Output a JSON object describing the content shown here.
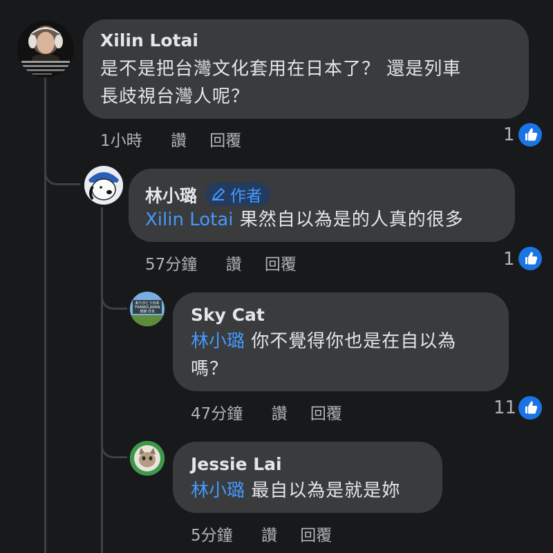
{
  "comments": [
    {
      "author": "Xilin Lotai",
      "text_lines": [
        "是不是把台灣文化套用在日本了？ 還是列車",
        "長歧視台灣人呢？"
      ],
      "time": "1小時",
      "like_label": "讚",
      "reply_label": "回覆",
      "like_count": "1"
    },
    {
      "author": "林小璐",
      "author_badge": "作者",
      "mention": "Xilin Lotai",
      "text": "果然自以為是的人真的很多",
      "time": "57分鐘",
      "like_label": "讚",
      "reply_label": "回覆",
      "like_count": "1"
    },
    {
      "author": "Sky Cat",
      "mention": "林小璐",
      "text_line1": "你不覺得你也是在自以為",
      "text_line2": "嗎？",
      "time": "47分鐘",
      "like_label": "讚",
      "reply_label": "回覆",
      "like_count": "11",
      "avatar_text_1": "ありがとう日本",
      "avatar_text_2": "THANKS JAPAN",
      "avatar_text_3": "感謝 日本"
    },
    {
      "author": "Jessie Lai",
      "mention": "林小璐",
      "text": "最自以為是就是妳",
      "time": "5分鐘",
      "like_label": "讚",
      "reply_label": "回覆"
    }
  ],
  "colors": {
    "background": "#18191a",
    "bubble": "#3a3b3c",
    "mention": "#4599ff",
    "like_blue": "#1b74e4",
    "meta_gray": "#b0b3b8"
  },
  "icons": [
    "like-thumb-icon",
    "pencil-icon"
  ]
}
